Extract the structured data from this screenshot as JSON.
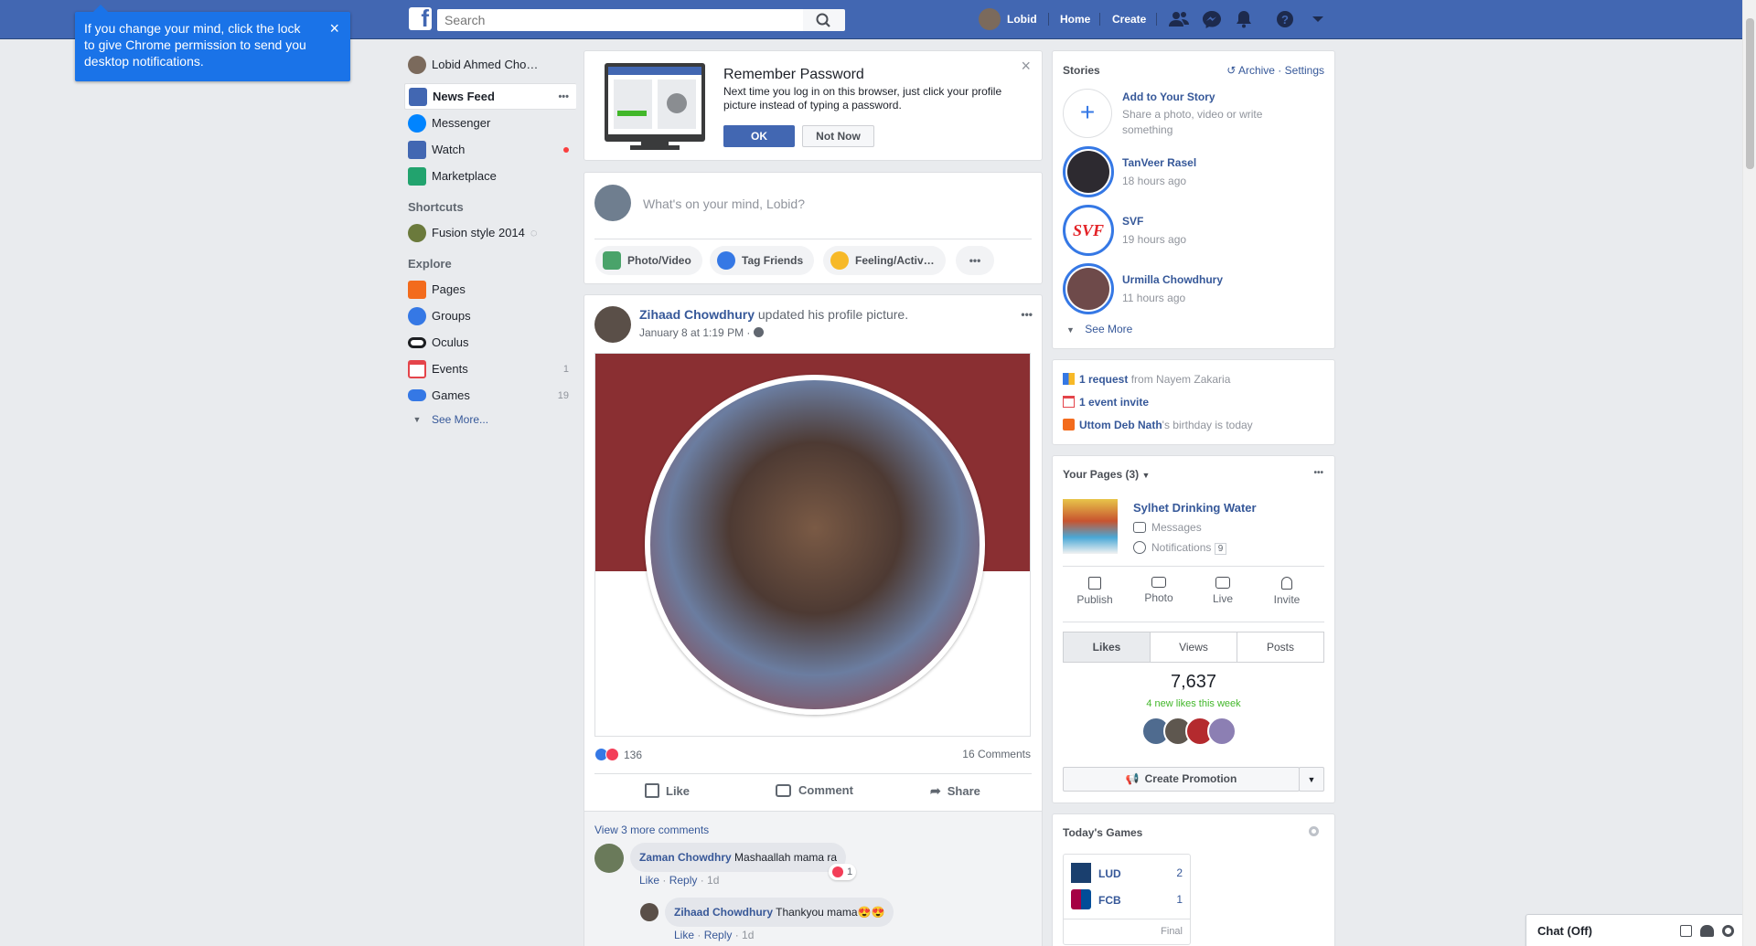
{
  "topbar": {
    "search_placeholder": "Search",
    "user_name": "Lobid",
    "home": "Home",
    "create": "Create"
  },
  "chrome_tip": {
    "text": "If you change your mind, click the lock to give Chrome permission to send you desktop notifications.",
    "close": "×"
  },
  "leftnav": {
    "profile": "Lobid Ahmed Cho…",
    "items": [
      {
        "label": "News Feed",
        "color": "#4267b2"
      },
      {
        "label": "Messenger",
        "color": "#0084ff"
      },
      {
        "label": "Watch",
        "color": "#4267b2"
      },
      {
        "label": "Marketplace",
        "color": "#22a36e"
      }
    ],
    "shortcuts_head": "Shortcuts",
    "shortcut": "Fusion style 2014",
    "explore_head": "Explore",
    "explore": [
      {
        "label": "Pages",
        "count": "",
        "color": "#f36b1c"
      },
      {
        "label": "Groups",
        "count": "",
        "color": "#3578e5"
      },
      {
        "label": "Oculus",
        "count": "",
        "color": "#1c1e21"
      },
      {
        "label": "Events",
        "count": "1",
        "color": "#e4444a"
      },
      {
        "label": "Games",
        "count": "19",
        "color": "#3578e5"
      }
    ],
    "see_more": "See More..."
  },
  "remember": {
    "title": "Remember Password",
    "text": "Next time you log in on this browser, just click your profile picture instead of typing a password.",
    "ok": "OK",
    "not_now": "Not Now",
    "close": "×"
  },
  "composer": {
    "placeholder": "What's on your mind, Lobid?",
    "photo": "Photo/Video",
    "tag": "Tag Friends",
    "feeling": "Feeling/Activ…",
    "more": "•••"
  },
  "post": {
    "author": "Zihaad Chowdhury",
    "action": " updated his profile picture.",
    "time": "January 8 at 1:19 PM · ",
    "menu": "•••",
    "reactions": "136",
    "comments_count": "16 Comments",
    "like": "Like",
    "comment": "Comment",
    "share": "Share",
    "view_more": "View 3 more comments",
    "comments": [
      {
        "author": "Zaman Chowdhry",
        "text": "Mashaallah mama ra",
        "like": "Like",
        "reply": "Reply",
        "time": "1d",
        "reaction_count": "1"
      },
      {
        "author": "Zihaad Chowdhury",
        "text": "Thankyou mama😍😍",
        "like": "Like",
        "reply": "Reply",
        "time": "1d"
      }
    ]
  },
  "stories": {
    "title": "Stories",
    "archive": "Archive",
    "settings": "Settings",
    "add_title": "Add to Your Story",
    "add_sub": "Share a photo, video or write something",
    "items": [
      {
        "name": "TanVeer Rasel",
        "time": "18 hours ago"
      },
      {
        "name": "SVF",
        "time": "19 hours ago",
        "logo": "SVF"
      },
      {
        "name": "Urmilla Chowdhury",
        "time": "11 hours ago"
      }
    ],
    "see_more": "See More"
  },
  "requests": {
    "req_bold": "1 request",
    "req_rest": " from Nayem Zakaria",
    "event": "1 event invite",
    "bday_name": "Uttom Deb Nath",
    "bday_rest": "'s birthday is today"
  },
  "pages": {
    "title": "Your Pages (3)",
    "menu": "•••",
    "page_name": "Sylhet Drinking Water",
    "messages": "Messages",
    "notifications": "Notifications",
    "notif_count": "9",
    "actions": [
      "Publish",
      "Photo",
      "Live",
      "Invite"
    ],
    "tabs": [
      "Likes",
      "Views",
      "Posts"
    ],
    "likes": "7,637",
    "new_likes": "4 new likes this week",
    "promotion": "Create Promotion"
  },
  "games": {
    "title": "Today's Games",
    "teams": [
      {
        "name": "LUD",
        "score": "2"
      },
      {
        "name": "FCB",
        "score": "1"
      }
    ],
    "status": "Final"
  },
  "chat": {
    "label": "Chat (Off)"
  }
}
